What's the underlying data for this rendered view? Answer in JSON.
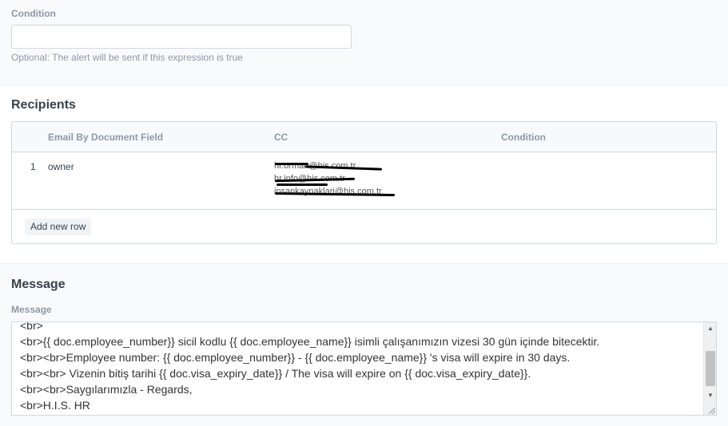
{
  "condition": {
    "label": "Condition",
    "value": "",
    "help": "Optional: The alert will be sent if this expression is true"
  },
  "recipients": {
    "title": "Recipients",
    "columns": [
      "Email By Document Field",
      "CC",
      "Condition"
    ],
    "rows": [
      {
        "index": "1",
        "email_by_field": "owner",
        "cc": [
          "hr.orman@his.com.tr",
          "hr.info@his.com.tr",
          "insankaynaklari@his.com.tr"
        ],
        "condition": ""
      }
    ],
    "add_row_label": "Add new row"
  },
  "message": {
    "title": "Message",
    "label": "Message",
    "lines": [
      "<br>",
      "<br>{{ doc.employee_number}} sicil kodlu {{ doc.employee_name}} isimli çalışanımızın vizesi 30 gün içinde bitecektir.",
      "<br><br>Employee number: {{ doc.employee_number}} - {{ doc.employee_name}} 's visa will expire in 30 days.",
      "<br><br> Vizenin bitiş tarihi {{ doc.visa_expiry_date}} / The visa will expire on {{ doc.visa_expiry_date}}.",
      "<br><br>Saygılarımızla - Regards,",
      "<br>H.I.S. HR"
    ]
  }
}
